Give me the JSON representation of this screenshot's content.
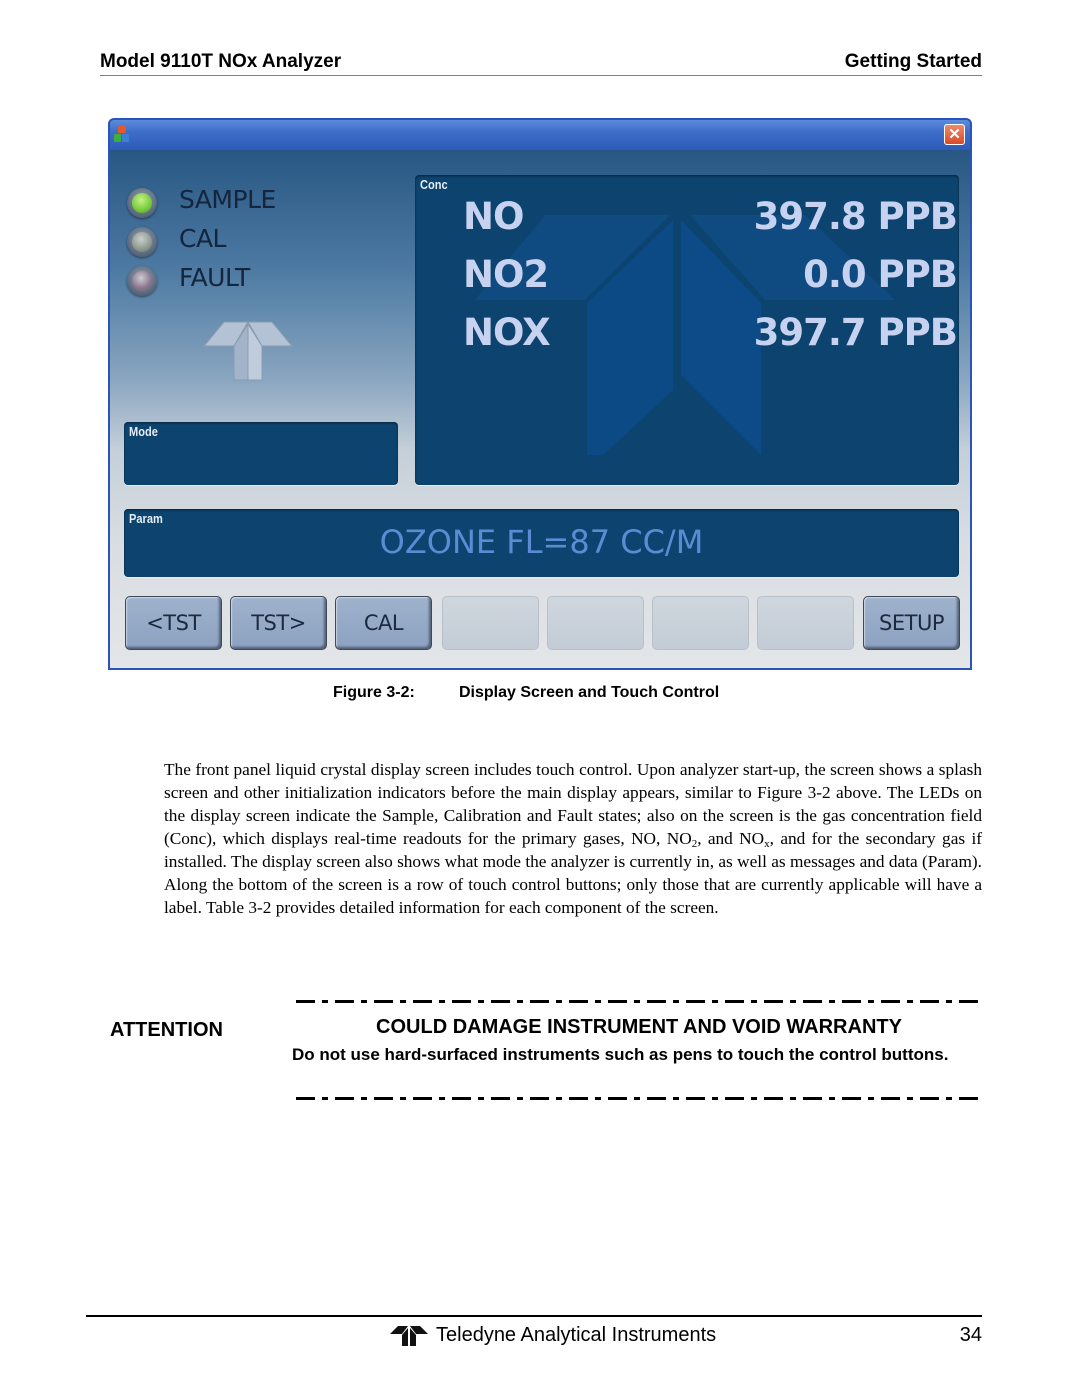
{
  "header": {
    "title": "Model 9110T NOx Analyzer",
    "section": "Getting Started"
  },
  "screen": {
    "window": {
      "app_icon": "app-icon",
      "close_icon": "close-icon",
      "close_glyph": "✕"
    },
    "leds": [
      {
        "label": "SAMPLE",
        "state": "on",
        "color": "#7ccf3f"
      },
      {
        "label": "CAL",
        "state": "off",
        "color": "#8f9a8e"
      },
      {
        "label": "FAULT",
        "state": "off",
        "color": "#8f7390"
      }
    ],
    "conc": {
      "label": "Conc",
      "rows": [
        {
          "gas": "NO",
          "value": "397.8 PPB"
        },
        {
          "gas": "NO2",
          "value": "0.0 PPB"
        },
        {
          "gas": "NOX",
          "value": "397.7 PPB"
        }
      ]
    },
    "mode": {
      "label": "Mode",
      "value": ""
    },
    "param": {
      "label": "Param",
      "value": "OZONE FL=87 CC/M"
    },
    "buttons": [
      {
        "label": "<TST",
        "enabled": true
      },
      {
        "label": "TST>",
        "enabled": true
      },
      {
        "label": "CAL",
        "enabled": true
      },
      {
        "label": "",
        "enabled": false
      },
      {
        "label": "",
        "enabled": false
      },
      {
        "label": "",
        "enabled": false
      },
      {
        "label": "",
        "enabled": false
      },
      {
        "label": "SETUP",
        "enabled": true
      }
    ]
  },
  "caption": {
    "number": "Figure 3-2:",
    "title": "Display Screen and Touch Control"
  },
  "body": {
    "p1_a": "The front panel liquid crystal display screen includes touch control. Upon analyzer start-up, the screen shows a splash screen and other initialization indicators before the main display appears, similar to Figure 3-2 above. The LEDs on the display screen indicate the Sample, Calibration and Fault states; also on the screen is the gas concentration field (Conc), which displays real-time readouts for the primary gases, NO, NO",
    "p1_sub1": "2",
    "p1_b": ", and NO",
    "p1_sub2": "x",
    "p1_c": ", and for the secondary gas if installed. The display screen also shows what mode the analyzer is currently in, as well as messages and data (Param). Along the bottom of the screen is a row of touch control buttons; only those that are currently applicable will have a label. Table 3-2 provides detailed information for each component of the screen."
  },
  "attention": {
    "label": "ATTENTION",
    "title": "COULD DAMAGE INSTRUMENT AND VOID WARRANTY",
    "text": "Do not use hard-surfaced instruments such as pens to touch the control buttons."
  },
  "footer": {
    "company": "Teledyne Analytical Instruments",
    "page": "34",
    "logo_icon": "teledyne-logo-icon"
  }
}
